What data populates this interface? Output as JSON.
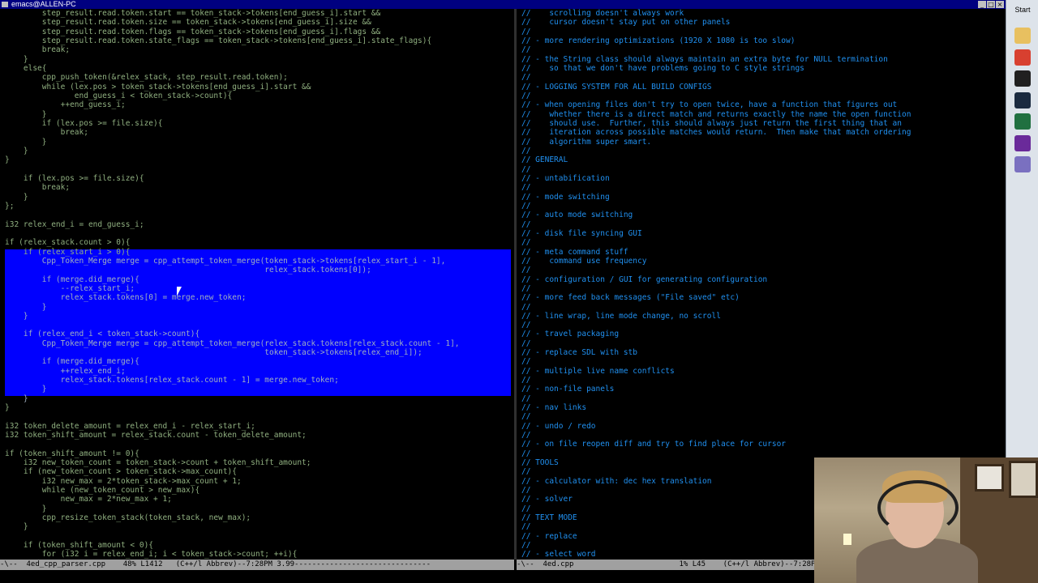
{
  "window": {
    "title": "emacs@ALLEN-PC",
    "min": "_",
    "max": "□",
    "close": "×"
  },
  "left_buffer": {
    "lines": [
      "        step_result.read.token.start == token_stack->tokens[end_guess_i].start &&",
      "        step_result.read.token.size == token_stack->tokens[end_guess_i].size &&",
      "        step_result.read.token.flags == token_stack->tokens[end_guess_i].flags &&",
      "        step_result.read.token.state_flags == token_stack->tokens[end_guess_i].state_flags){",
      "        break;",
      "    }",
      "    else{",
      "        cpp_push_token(&relex_stack, step_result.read.token);",
      "        while (lex.pos > token_stack->tokens[end_guess_i].start &&",
      "               end_guess_i < token_stack->count){",
      "            ++end_guess_i;",
      "        }",
      "        if (lex.pos >= file.size){",
      "            break;",
      "        }",
      "    }",
      "}",
      "",
      "    if (lex.pos >= file.size){",
      "        break;",
      "    }",
      "};",
      "",
      "i32 relex_end_i = end_guess_i;",
      "",
      "if (relex_stack.count > 0){",
      "    if (relex_start_i > 0){",
      "        Cpp_Token_Merge merge = cpp_attempt_token_merge(token_stack->tokens[relex_start_i - 1],",
      "                                                        relex_stack.tokens[0]);",
      "        if (merge.did_merge){",
      "            --relex_start_i;",
      "            relex_stack.tokens[0] = merge.new_token;",
      "        }",
      "    }",
      "",
      "    if (relex_end_i < token_stack->count){",
      "        Cpp_Token_Merge merge = cpp_attempt_token_merge(relex_stack.tokens[relex_stack.count - 1],",
      "                                                        token_stack->tokens[relex_end_i]);",
      "        if (merge.did_merge){",
      "            ++relex_end_i;",
      "            relex_stack.tokens[relex_stack.count - 1] = merge.new_token;",
      "        }",
      "    }",
      "}",
      "",
      "i32 token_delete_amount = relex_end_i - relex_start_i;",
      "i32 token_shift_amount = relex_stack.count - token_delete_amount;",
      "",
      "if (token_shift_amount != 0){",
      "    i32 new_token_count = token_stack->count + token_shift_amount;",
      "    if (new_token_count > token_stack->max_count){",
      "        i32 new_max = 2*token_stack->max_count + 1;",
      "        while (new_token_count > new_max){",
      "            new_max = 2*new_max + 1;",
      "        }",
      "        cpp_resize_token_stack(token_stack, new_max);",
      "    }",
      "",
      "    if (token_shift_amount < 0){",
      "        for (i32 i = relex_end_i; i < token_stack->count; ++i){"
    ]
  },
  "right_buffer": {
    "lines": [
      "//    scrolling doesn't always work",
      "//    cursor doesn't stay put on other panels",
      "//",
      "// - more rendering optimizations (1920 X 1080 is too slow)",
      "//",
      "// - the String class should always maintain an extra byte for NULL termination",
      "//    so that we don't have problems going to C style strings",
      "//",
      "// - LOGGING SYSTEM FOR ALL BUILD CONFIGS",
      "//",
      "// - when opening files don't try to open twice, have a function that figures out",
      "//    whether there is a direct match and returns exactly the name the open function",
      "//    should use.  Further, this should always just return the first thing that an",
      "//    iteration across possible matches would return.  Then make that match ordering",
      "//    algorithm super smart.",
      "//",
      "// GENERAL",
      "//",
      "// - untabification",
      "//",
      "// - mode switching",
      "//",
      "// - auto mode switching",
      "//",
      "// - disk file syncing GUI",
      "//",
      "// - meta command stuff",
      "//    command use frequency",
      "//",
      "// - configuration / GUI for generating configuration",
      "//",
      "// - more feed back messages (\"File saved\" etc)",
      "//",
      "// - line wrap, line mode change, no scroll",
      "//",
      "// - travel packaging",
      "//",
      "// - replace SDL with stb",
      "//",
      "// - multiple live name conflicts",
      "//",
      "// - non-file panels",
      "//",
      "// - nav links",
      "//",
      "// - undo / redo",
      "//",
      "// - on file reopen diff and try to find place for cursor",
      "//",
      "// TOOLS",
      "//",
      "// - calculator with: dec hex translation",
      "//",
      "// - solver",
      "//",
      "// TEXT MODE",
      "//",
      "// - replace",
      "//",
      "// - select word"
    ]
  },
  "modelines": {
    "left": "-\\--  4ed_cpp_parser.cpp    48% L1412   (C++/l Abbrev)--7:28PM 3.99-------------------------------",
    "right": "-\\--  4ed.cpp                        1% L45    (C++/l Abbrev)--7:28PM 3.99---------------"
  },
  "taskbar": {
    "start_label": "Start",
    "apps": [
      {
        "name": "folder-app",
        "color": "#e8c060"
      },
      {
        "name": "chrome-app",
        "color": "#d84030"
      },
      {
        "name": "terminal-app",
        "color": "#202020"
      },
      {
        "name": "steam-app",
        "color": "#1a2a40"
      },
      {
        "name": "excel-app",
        "color": "#207040"
      },
      {
        "name": "visual-studio-app",
        "color": "#6a2a9a"
      },
      {
        "name": "emacs-app",
        "color": "#7a70c0"
      }
    ]
  }
}
